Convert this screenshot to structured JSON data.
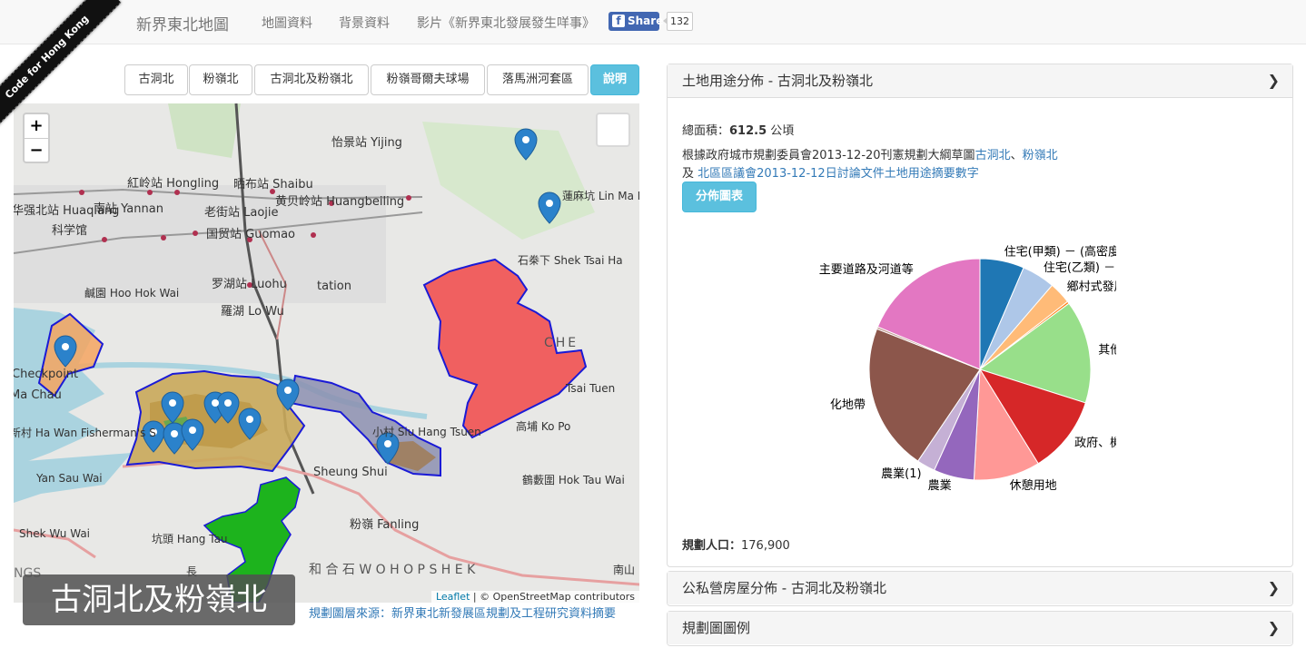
{
  "navbar": {
    "brand": "新界東北地圖",
    "links": [
      "地圖資料",
      "背景資料",
      "影片《新界東北發展發生咩事》"
    ],
    "share_label": "Share",
    "share_count": "132"
  },
  "ribbon": "Code for Hong Kong",
  "area_buttons": [
    "古洞北",
    "粉嶺北",
    "古洞北及粉嶺北",
    "粉嶺哥爾夫球場",
    "落馬洲河套區",
    "說明"
  ],
  "map": {
    "zoom_in": "+",
    "zoom_out": "−",
    "attribution_link": "Leaflet",
    "attribution_text": "| © OpenStreetMap contributors",
    "place_labels": [
      "怡景站 Yijing",
      "紅岭站 Hongling",
      "晒布站 Shaibu",
      "黄贝岭站 Huangbeiling",
      "蓮麻坑 Lin Ma H",
      "华强北站 Huaqiang",
      "南站 Yannan",
      "老街站 Laojie",
      "科学馆",
      "国贸站 Guomao",
      "石桊下 Shek Tsai Ha",
      "罗湖站 Luohu",
      "tation",
      "羅湖 Lo Wu",
      "鹹園 Hoo Hok Wai",
      "Checkpoint",
      "Ma Chau",
      "CHE",
      "Tsai Tuen",
      "新村 Ha Wan Fisherman's S",
      "小村 Siu Hang Tsuen",
      "高埔 Ko Po",
      "Yan Sau Wai",
      "Sheung Shui",
      "鶴藪圍 Hok Tau Wai",
      "粉嶺 Fanling",
      "Shek Wu Wai",
      "坑頭 Hang Tau",
      "和 合 石  W O  H O P  S H E K",
      "NGS",
      "南山",
      "長"
    ],
    "region_title": "古洞北及粉嶺北",
    "source": "規劃圖層來源：新界東北新發展區規劃及工程研究資料摘要",
    "region_colors": {
      "west": "#f4a460",
      "central": "#f06060",
      "green": "#1db31d",
      "outline": "#1a1ad6"
    }
  },
  "panels": {
    "landuse": {
      "title": "土地用途分佈 - 古洞北及粉嶺北",
      "area_prefix": "總面積：",
      "area_value": "612.5",
      "area_unit": " 公頃",
      "source_prefix": "根據政府城市規劃委員會2013-12-20刊憲規劃大綱草圖",
      "source_link1": "古洞北",
      "source_sep": "、",
      "source_link2": "粉嶺北",
      "source_line2_prefix": "及 ",
      "source_link3": "北區區議會2013-12-12日討論文件土地用途摘要數字",
      "chart_button": "分佈圖表",
      "population_label": "規劃人口：",
      "population_value": "176,900"
    },
    "housing": {
      "title": "公私營房屋分佈 - 古洞北及粉嶺北"
    },
    "legend": {
      "title": "規劃圖圖例"
    }
  },
  "chart_data": {
    "type": "pie",
    "title": "",
    "slices": [
      {
        "label": "住宅(甲類) － (高密度)",
        "value": 6.0,
        "color": "#1f77b4"
      },
      {
        "label": "住宅(乙類) － (中密度)",
        "value": 4.5,
        "color": "#aec7e8"
      },
      {
        "label": "鄉村式發展",
        "value": 3.0,
        "color": "#ffbb78"
      },
      {
        "label": "",
        "value": 0.3,
        "color": "#ff7f0e"
      },
      {
        "label": "其他指定",
        "value": 14.0,
        "color": "#98df8a"
      },
      {
        "label": "政府、機構或社",
        "value": 10.5,
        "color": "#d62728"
      },
      {
        "label": "休憩用地",
        "value": 9.0,
        "color": "#ff9896"
      },
      {
        "label": "農業",
        "value": 5.5,
        "color": "#9467bd"
      },
      {
        "label": "農業(1)",
        "value": 2.5,
        "color": "#c5b0d5"
      },
      {
        "label": "化地帶",
        "value": 20.0,
        "color": "#8c564b"
      },
      {
        "label": "",
        "value": 0.3,
        "color": "#c49c94"
      },
      {
        "label": "主要道路及河道等",
        "value": 17.4,
        "color": "#e377c2"
      }
    ]
  }
}
